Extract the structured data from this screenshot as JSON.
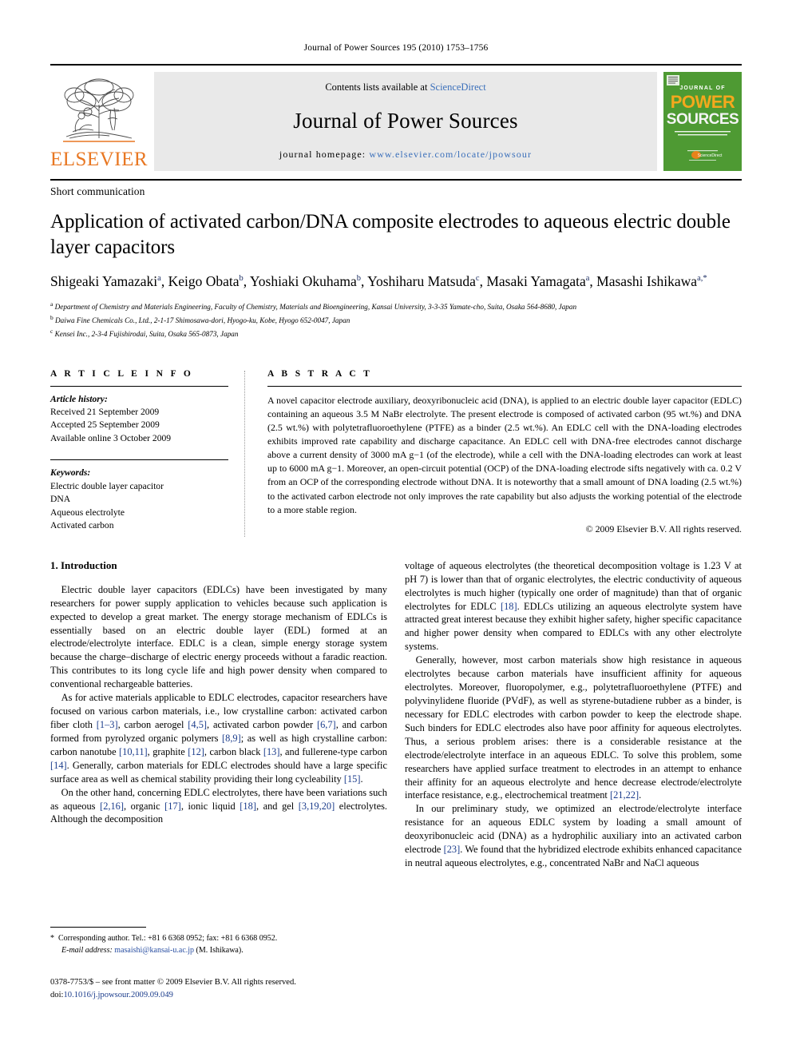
{
  "running_head": "Journal of Power Sources 195 (2010) 1753–1756",
  "masthead": {
    "publisher": "ELSEVIER",
    "contents_prefix": "Contents lists available at ",
    "contents_link": "ScienceDirect",
    "journal_title": "Journal of Power Sources",
    "homepage_label": "journal homepage:",
    "homepage_url": "www.elsevier.com/locate/jpowsour",
    "cover": {
      "line1": "JOURNAL OF",
      "line2": "POWER",
      "line3": "SOURCES",
      "tagline": "The International Journal on the Science and Technology of Batteries, Fuel Cells and other Electrochemical Systems",
      "badge": "ScienceDirect",
      "bg_color": "#4e9a33"
    },
    "accent_orange": "#E87722",
    "link_blue": "#3a6fba"
  },
  "article": {
    "section_type": "Short communication",
    "title": "Application of activated carbon/DNA composite electrodes to aqueous electric double layer capacitors",
    "authors": [
      {
        "name": "Shigeaki Yamazaki",
        "sup": "a",
        "sep": ", "
      },
      {
        "name": "Keigo Obata",
        "sup": "b",
        "sep": ", "
      },
      {
        "name": "Yoshiaki Okuhama",
        "sup": "b",
        "sep": ", "
      },
      {
        "name": "Yoshiharu Matsuda",
        "sup": "c",
        "sep": ", "
      },
      {
        "name": "Masaki Yamagata",
        "sup": "a",
        "sep": ", "
      },
      {
        "name": "Masashi Ishikawa",
        "sup": "a,*",
        "sep": ""
      }
    ],
    "affiliations": [
      {
        "mark": "a",
        "text": "Department of Chemistry and Materials Engineering, Faculty of Chemistry, Materials and Bioengineering, Kansai University, 3-3-35 Yamate-cho, Suita, Osaka 564-8680, Japan"
      },
      {
        "mark": "b",
        "text": "Daiwa Fine Chemicals Co., Ltd., 2-1-17 Shimosawa-dori, Hyogo-ku, Kobe, Hyogo 652-0047, Japan"
      },
      {
        "mark": "c",
        "text": "Kensei Inc., 2-3-4 Fujishirodai, Suita, Osaka 565-0873, Japan"
      }
    ]
  },
  "article_info": {
    "heading": "A R T I C L E    I N F O",
    "history_label": "Article history:",
    "history": [
      "Received 21 September 2009",
      "Accepted 25 September 2009",
      "Available online 3 October 2009"
    ],
    "keywords_label": "Keywords:",
    "keywords": [
      "Electric double layer capacitor",
      "DNA",
      "Aqueous electrolyte",
      "Activated carbon"
    ]
  },
  "abstract": {
    "heading": "A B S T R A C T",
    "text": "A novel capacitor electrode auxiliary, deoxyribonucleic acid (DNA), is applied to an electric double layer capacitor (EDLC) containing an aqueous 3.5 M NaBr electrolyte. The present electrode is composed of activated carbon (95 wt.%) and DNA (2.5 wt.%) with polytetrafluoroethylene (PTFE) as a binder (2.5 wt.%). An EDLC cell with the DNA-loading electrodes exhibits improved rate capability and discharge capacitance. An EDLC cell with DNA-free electrodes cannot discharge above a current density of 3000 mA g−1 (of the electrode), while a cell with the DNA-loading electrodes can work at least up to 6000 mA g−1. Moreover, an open-circuit potential (OCP) of the DNA-loading electrode sifts negatively with ca. 0.2 V from an OCP of the corresponding electrode without DNA. It is noteworthy that a small amount of DNA loading (2.5 wt.%) to the activated carbon electrode not only improves the rate capability but also adjusts the working potential of the electrode to a more stable region.",
    "copyright": "© 2009 Elsevier B.V. All rights reserved."
  },
  "body": {
    "section_number_title": "1.  Introduction",
    "left_paragraphs": [
      "Electric double layer capacitors (EDLCs) have been investigated by many researchers for power supply application to vehicles because such application is expected to develop a great market. The energy storage mechanism of EDLCs is essentially based on an electric double layer (EDL) formed at an electrode/electrolyte interface. EDLC is a clean, simple energy storage system because the charge–discharge of electric energy proceeds without a faradic reaction. This contributes to its long cycle life and high power density when compared to conventional rechargeable batteries.",
      "As for active materials applicable to EDLC electrodes, capacitor researchers have focused on various carbon materials, i.e., low crystalline carbon: activated carbon fiber cloth [1–3], carbon aerogel [4,5], activated carbon powder [6,7], and carbon formed from pyrolyzed organic polymers [8,9]; as well as high crystalline carbon: carbon nanotube [10,11], graphite [12], carbon black [13], and fullerene-type carbon [14]. Generally, carbon materials for EDLC electrodes should have a large specific surface area as well as chemical stability providing their long cycleability [15].",
      "On the other hand, concerning EDLC electrolytes, there have been variations such as aqueous [2,16], organic [17], ionic liquid [18], and gel [3,19,20] electrolytes. Although the decomposition"
    ],
    "right_paragraphs": [
      "voltage of aqueous electrolytes (the theoretical decomposition voltage is 1.23 V at pH 7) is lower than that of organic electrolytes, the electric conductivity of aqueous electrolytes is much higher (typically one order of magnitude) than that of organic electrolytes for EDLC [18]. EDLCs utilizing an aqueous electrolyte system have attracted great interest because they exhibit higher safety, higher specific capacitance and higher power density when compared to EDLCs with any other electrolyte systems.",
      "Generally, however, most carbon materials show high resistance in aqueous electrolytes because carbon materials have insufficient affinity for aqueous electrolytes. Moreover, fluoropolymer, e.g., polytetrafluoroethylene (PTFE) and polyvinylidene fluoride (PVdF), as well as styrene-butadiene rubber as a binder, is necessary for EDLC electrodes with carbon powder to keep the electrode shape. Such binders for EDLC electrodes also have poor affinity for aqueous electrolytes. Thus, a serious problem arises: there is a considerable resistance at the electrode/electrolyte interface in an aqueous EDLC. To solve this problem, some researchers have applied surface treatment to electrodes in an attempt to enhance their affinity for an aqueous electrolyte and hence decrease electrode/electrolyte interface resistance, e.g., electrochemical treatment [21,22].",
      "In our preliminary study, we optimized an electrode/electrolyte interface resistance for an aqueous EDLC system by loading a small amount of deoxyribonucleic acid (DNA) as a hydrophilic auxiliary into an activated carbon electrode [23]. We found that the hybridized electrode exhibits enhanced capacitance in neutral aqueous electrolytes, e.g., concentrated NaBr and NaCl aqueous"
    ]
  },
  "footnote": {
    "star": "*",
    "corresponding": "Corresponding author. Tel.: +81 6 6368 0952; fax: +81 6 6368 0952.",
    "email_label": "E-mail address:",
    "email": "masaishi@kansai-u.ac.jp",
    "email_owner": "(M. Ishikawa)."
  },
  "footer": {
    "issn_line": "0378-7753/$ – see front matter © 2009 Elsevier B.V. All rights reserved.",
    "doi_label": "doi:",
    "doi": "10.1016/j.jpowsour.2009.09.049"
  }
}
